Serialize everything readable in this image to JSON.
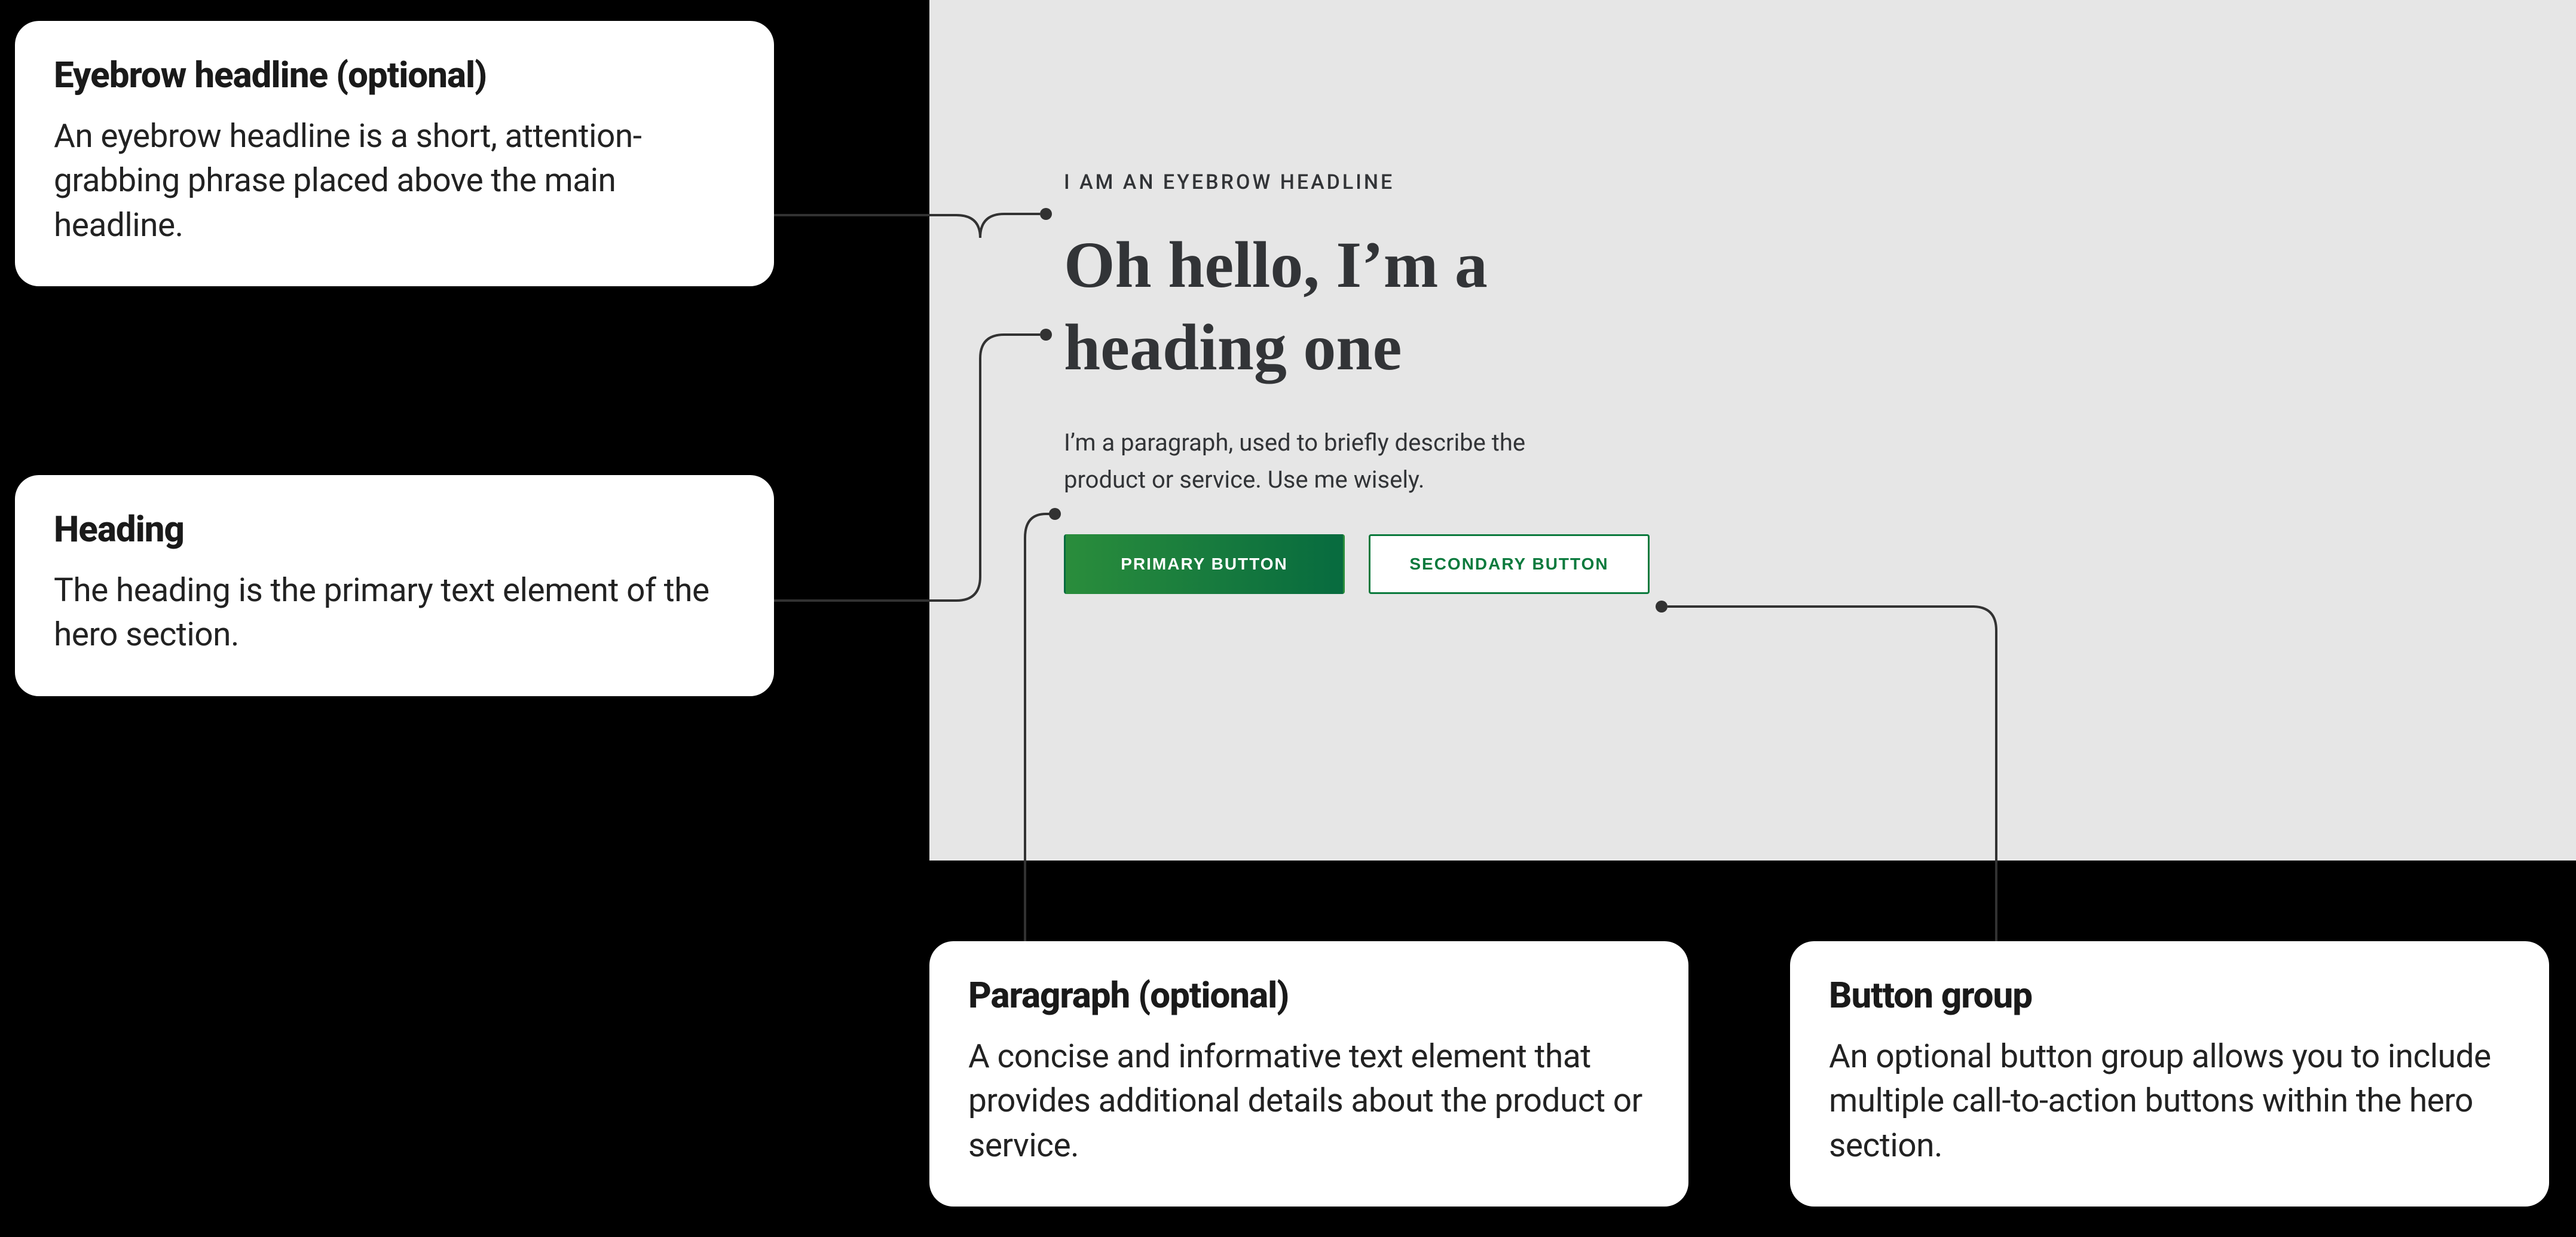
{
  "mockup": {
    "eyebrow": "I AM AN EYEBROW HEADLINE",
    "heading": "Oh hello, I’m a\nheading one",
    "paragraph": "I’m a paragraph, used to briefly describe the product or service. Use me wisely.",
    "primary_button": "PRIMARY BUTTON",
    "secondary_button": "SECONDARY BUTTON"
  },
  "callouts": {
    "eyebrow": {
      "title": "Eyebrow headline (optional)",
      "body": "An eyebrow headline is a short, attention-grabbing phrase placed above the main headline."
    },
    "heading": {
      "title": "Heading",
      "body": "The heading is the primary text element of the hero section."
    },
    "paragraph": {
      "title": "Paragraph (optional)",
      "body": "A concise and informative text element that provides additional details about the product or service."
    },
    "buttons": {
      "title": "Button group",
      "body": "An optional button group allows you to include multiple call-to-action buttons within the hero section."
    }
  }
}
